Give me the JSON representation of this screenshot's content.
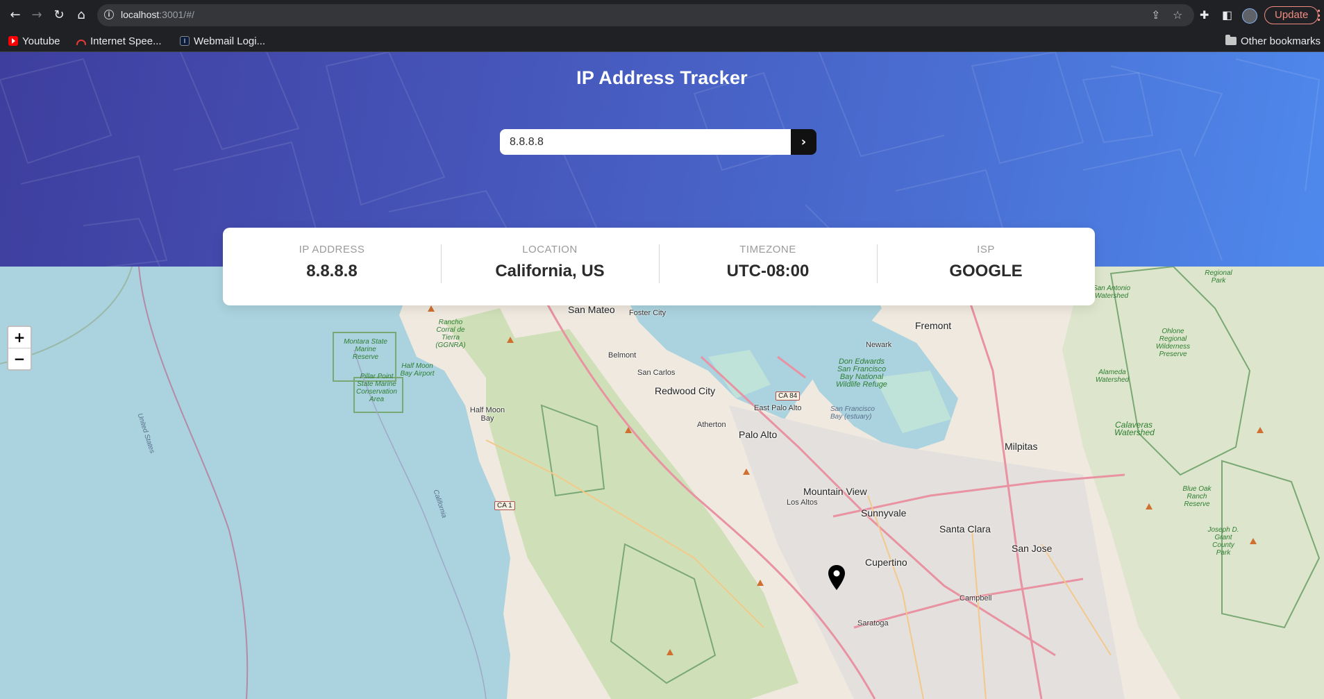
{
  "browser": {
    "url_host": "localhost",
    "url_rest": ":3001/#/",
    "update_label": "Update",
    "bookmarks": [
      {
        "label": "Youtube",
        "icon": "youtube-icon"
      },
      {
        "label": "Internet Spee...",
        "icon": "speedometer-icon"
      },
      {
        "label": "Webmail Logi...",
        "icon": "webmail-icon"
      }
    ],
    "other_bookmarks": "Other bookmarks"
  },
  "app": {
    "title": "IP Address Tracker",
    "search_value": "8.8.8.8",
    "submit_icon": "chevron-right-icon",
    "accent_color": "#4a6ed2"
  },
  "info": {
    "ip_label": "IP ADDRESS",
    "ip_value": "8.8.8.8",
    "location_label": "LOCATION",
    "location_value": "California, US",
    "timezone_label": "TIMEZONE",
    "timezone_value": "UTC-08:00",
    "isp_label": "ISP",
    "isp_value": "GOOGLE"
  },
  "map": {
    "zoom_in": "+",
    "zoom_out": "−",
    "cities": [
      "San Mateo",
      "Foster City",
      "Belmont",
      "San Carlos",
      "Redwood City",
      "Atherton",
      "Palo Alto",
      "East Palo Alto",
      "Mountain View",
      "Los Altos",
      "Sunnyvale",
      "Santa Clara",
      "San Jose",
      "Cupertino",
      "Campbell",
      "Saratoga",
      "Milpitas",
      "Fremont",
      "Newark",
      "Half Moon Bay"
    ],
    "parks": [
      "Rancho Corral de Tierra (GGNRA)",
      "Montara State Marine Reserve",
      "Half Moon Bay Airport",
      "Pillar Point State Marine Conservation Area",
      "Don Edwards San Francisco Bay National Wildlife Refuge",
      "San Francisco Bay (estuary)",
      "Alameda Watershed",
      "Calaveras Watershed",
      "San Antonio Watershed",
      "Ohlone Regional Wilderness Preserve",
      "Blue Oak Ranch Reserve",
      "Joseph D. Grant County Park",
      "Regional Park"
    ],
    "shields": [
      "CA 84",
      "CA 1"
    ],
    "boundary_labels": [
      "United States",
      "California"
    ],
    "marker_icon": "location-pin-icon"
  }
}
